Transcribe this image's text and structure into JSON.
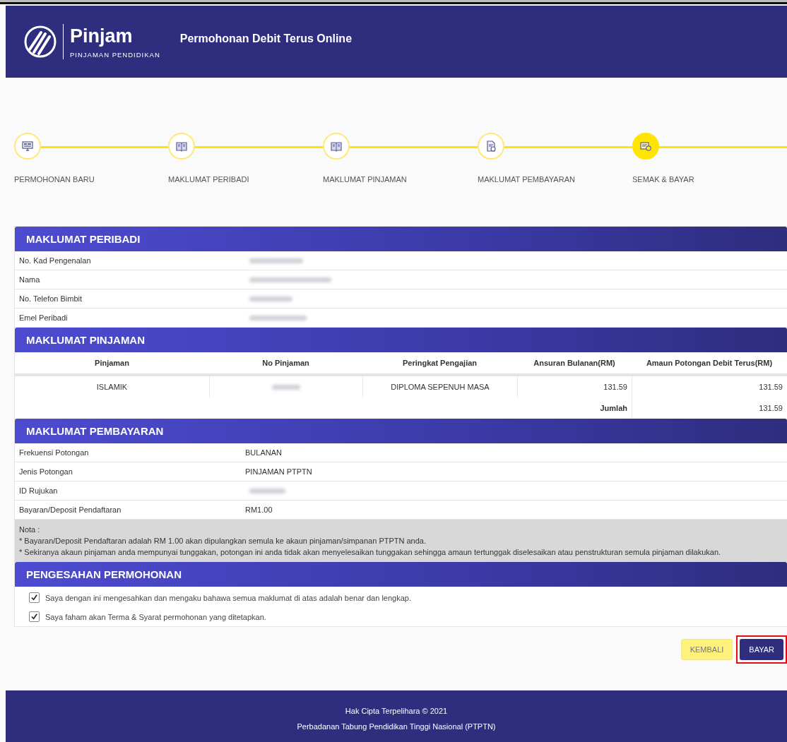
{
  "header": {
    "logo_name": "Pinjam",
    "logo_tagline": "PINJAMAN PENDIDIKAN",
    "title": "Permohonan Debit Terus Online"
  },
  "steps": [
    {
      "label": "PERMOHONAN BARU",
      "selected": false,
      "kind": "monitor"
    },
    {
      "label": "MAKLUMAT PERIBADI",
      "selected": false,
      "kind": "book"
    },
    {
      "label": "MAKLUMAT PINJAMAN",
      "selected": false,
      "kind": "book"
    },
    {
      "label": "MAKLUMAT PEMBAYARAN",
      "selected": false,
      "kind": "document"
    },
    {
      "label": "SEMAK & BAYAR",
      "selected": true,
      "kind": "payment"
    }
  ],
  "personal": {
    "title": "MAKLUMAT PERIBADI",
    "rows": [
      {
        "label": "No. Kad Pengenalan",
        "redacted": true
      },
      {
        "label": "Nama",
        "redacted": true
      },
      {
        "label": "No. Telefon Bimbit",
        "redacted": true
      },
      {
        "label": "Emel Peribadi",
        "redacted": true
      }
    ]
  },
  "loan": {
    "title": "MAKLUMAT PINJAMAN",
    "columns": [
      "Pinjaman",
      "No Pinjaman",
      "Peringkat Pengajian",
      "Ansuran Bulanan(RM)",
      "Amaun Potongan Debit Terus(RM)"
    ],
    "rows": [
      {
        "pinjaman": "ISLAMIK",
        "no_redacted": true,
        "peringkat": "DIPLOMA SEPENUH MASA",
        "ansuran": "131.59",
        "amaun": "131.59"
      }
    ],
    "total_label": "Jumlah",
    "total": "131.59"
  },
  "payment": {
    "title": "MAKLUMAT PEMBAYARAN",
    "rows": [
      {
        "label": "Frekuensi Potongan",
        "value": "BULANAN"
      },
      {
        "label": "Jenis Potongan",
        "value": "PINJAMAN PTPTN"
      },
      {
        "label": "ID Rujukan",
        "redacted": true
      },
      {
        "label": "Bayaran/Deposit Pendaftaran",
        "value": "RM1.00"
      }
    ]
  },
  "note": {
    "heading": "Nota :",
    "lines": [
      "* Bayaran/Deposit Pendaftaran adalah RM 1.00 akan dipulangkan semula ke akaun pinjaman/simpanan PTPTN anda.",
      "* Sekiranya akaun pinjaman anda mempunyai tunggakan, potongan ini anda tidak akan menyelesaikan tunggakan sehingga amaun tertunggak diselesaikan atau penstrukturan semula pinjaman dilakukan."
    ]
  },
  "confirmation": {
    "title": "PENGESAHAN PERMOHONAN",
    "items": [
      {
        "label": "Saya dengan ini mengesahkan dan mengaku bahawa semua maklumat di atas adalah benar dan lengkap.",
        "checked": true
      },
      {
        "label": "Saya faham akan Terma & Syarat permohonan yang ditetapkan.",
        "checked": true
      }
    ]
  },
  "buttons": [
    {
      "label": "KEMBALI",
      "kind": "secondary",
      "highlighted": false
    },
    {
      "label": "BAYAR",
      "kind": "primary",
      "highlighted": true
    }
  ],
  "footer": {
    "lines": [
      "Hak Cipta Terpelihara © 2021",
      "Perbadanan Tabung Pendidikan Tinggi Nasional (PTPTN)"
    ]
  }
}
